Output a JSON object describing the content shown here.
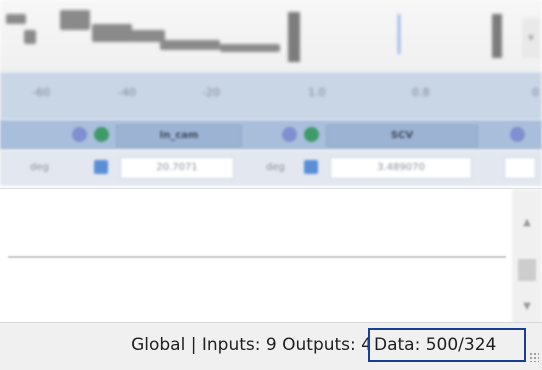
{
  "axis": {
    "ticks": [
      "-60",
      "-40",
      "-20",
      "1.0",
      "0.8",
      "0"
    ]
  },
  "channels": [
    {
      "label": "In_cam",
      "value": "20.7071",
      "unit": "deg"
    },
    {
      "label": "SCV",
      "value": "3.489070",
      "unit": "deg"
    }
  ],
  "status_bar": {
    "scope": "Global",
    "inputs_label": "Inputs:",
    "inputs_count": "9",
    "outputs_label": "Outputs:",
    "outputs_count": "4",
    "data_label": "Data:",
    "data_value": "500/324"
  },
  "colors": {
    "data_highlight_border": "#1b3f8f",
    "channel_header_bg": "#a9bedb",
    "axis_row_bg": "#c9d6e6"
  }
}
